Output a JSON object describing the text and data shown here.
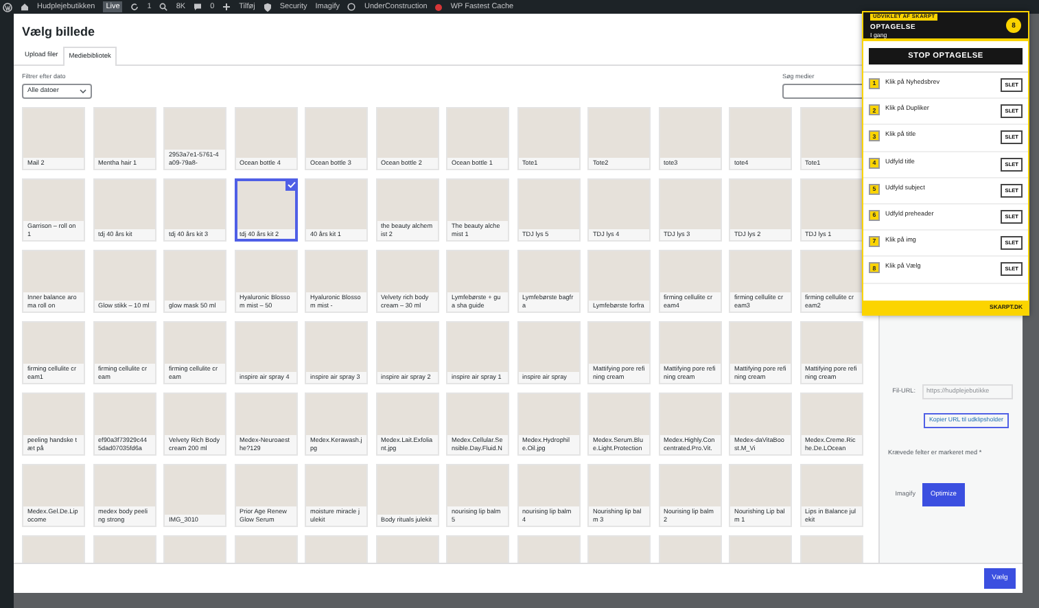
{
  "admin_bar": {
    "site": "Hudplejebutikken",
    "badge": "Live",
    "updates": "1",
    "stat": "8K",
    "comments": "0",
    "new": "Tilføj",
    "links": [
      "Security",
      "Imagify"
    ],
    "status_link": "UnderConstruction",
    "cache": "WP Fastest Cache"
  },
  "modal": {
    "title": "Vælg billede",
    "tabs": [
      {
        "label": "Upload filer",
        "selected": false
      },
      {
        "label": "Mediebibliotek",
        "selected": true
      }
    ],
    "filter": {
      "label": "Filtrer efter dato",
      "value": "Alle datoer"
    },
    "search": {
      "label": "Søg medier"
    },
    "media": [
      {
        "caption": "Mail 2",
        "selected": false
      },
      {
        "caption": "Mentha hair 1",
        "selected": false
      },
      {
        "caption": "2953a7e1-5761-4a09-79a8-",
        "selected": false
      },
      {
        "caption": "Ocean bottle 4",
        "selected": false
      },
      {
        "caption": "Ocean bottle 3",
        "selected": false
      },
      {
        "caption": "Ocean bottle 2",
        "selected": false
      },
      {
        "caption": "Ocean bottle 1",
        "selected": false
      },
      {
        "caption": "Tote1",
        "selected": false
      },
      {
        "caption": "Tote2",
        "selected": false
      },
      {
        "caption": "tote3",
        "selected": false
      },
      {
        "caption": "tote4",
        "selected": false
      },
      {
        "caption": "Tote1",
        "selected": false
      },
      {
        "caption": "Garrison – roll on 1",
        "selected": false
      },
      {
        "caption": "tdj 40 års kit",
        "selected": false
      },
      {
        "caption": "tdj 40 års kit 3",
        "selected": false
      },
      {
        "caption": "tdj 40 års kit 2",
        "selected": true
      },
      {
        "caption": "40 års kit 1",
        "selected": false
      },
      {
        "caption": "the beauty alchemist 2",
        "selected": false
      },
      {
        "caption": "The beauty alchemist 1",
        "selected": false
      },
      {
        "caption": "TDJ lys 5",
        "selected": false
      },
      {
        "caption": "TDJ lys 4",
        "selected": false
      },
      {
        "caption": "TDJ lys 3",
        "selected": false
      },
      {
        "caption": "TDJ lys 2",
        "selected": false
      },
      {
        "caption": "TDJ lys 1",
        "selected": false
      },
      {
        "caption": "Inner balance aroma roll on",
        "selected": false
      },
      {
        "caption": "Glow stikk – 10 ml",
        "selected": false
      },
      {
        "caption": "glow mask 50 ml",
        "selected": false
      },
      {
        "caption": "Hyaluronic Blossom mist – 50",
        "selected": false
      },
      {
        "caption": "Hyaluronic Blossom mist -",
        "selected": false
      },
      {
        "caption": "Velvety rich body cream – 30 ml",
        "selected": false
      },
      {
        "caption": "Lymfebørste + gua sha guide",
        "selected": false
      },
      {
        "caption": "Lymfebørste bagfra",
        "selected": false
      },
      {
        "caption": "Lymfebørste forfra",
        "selected": false
      },
      {
        "caption": "firming cellulite cream4",
        "selected": false
      },
      {
        "caption": "firming cellulite cream3",
        "selected": false
      },
      {
        "caption": "firming cellulite cream2",
        "selected": false
      },
      {
        "caption": "firming cellulite cream1",
        "selected": false
      },
      {
        "caption": "firming cellulite cream",
        "selected": false
      },
      {
        "caption": "firming cellulite cream",
        "selected": false
      },
      {
        "caption": "inspire air spray 4",
        "selected": false
      },
      {
        "caption": "inspire air spray 3",
        "selected": false
      },
      {
        "caption": "inspire air spray 2",
        "selected": false
      },
      {
        "caption": "inspire air spray 1",
        "selected": false
      },
      {
        "caption": "inspire air spray",
        "selected": false
      },
      {
        "caption": "Mattifying pore refining cream",
        "selected": false
      },
      {
        "caption": "Mattifying pore refining cream",
        "selected": false
      },
      {
        "caption": "Mattifying pore refining cream",
        "selected": false
      },
      {
        "caption": "Mattifying pore refining cream",
        "selected": false
      },
      {
        "caption": "peeling handske tæt på",
        "selected": false
      },
      {
        "caption": "ef90a3f73929c44 5dad07035fd6a",
        "selected": false
      },
      {
        "caption": "Velvety Rich Body cream 200 ml",
        "selected": false
      },
      {
        "caption": "Medex-Neuroaesthe?129",
        "selected": false
      },
      {
        "caption": "Medex.Kerawash.jpg",
        "selected": false
      },
      {
        "caption": "Medex.Lait.Exfoliant.jpg",
        "selected": false
      },
      {
        "caption": "Medex.Cellular.Sensible.Day.Fluid.N",
        "selected": false
      },
      {
        "caption": "Medex.Hydrophile.Oil.jpg",
        "selected": false
      },
      {
        "caption": "Medex.Serum.Blue.Light.Protection",
        "selected": false
      },
      {
        "caption": "Medex.Highly.Concentrated.Pro.Vit.",
        "selected": false
      },
      {
        "caption": "Medex-daVitaBoost.M_Vi",
        "selected": false
      },
      {
        "caption": "Medex.Creme.Riche.De.LOcean",
        "selected": false
      },
      {
        "caption": "Medex.Gel.De.Lipocome",
        "selected": false
      },
      {
        "caption": "medex body peeling strong",
        "selected": false
      },
      {
        "caption": "IMG_3010",
        "selected": false
      },
      {
        "caption": "Prior Age Renew Glow Serum",
        "selected": false
      },
      {
        "caption": "moisture miracle julekit",
        "selected": false
      },
      {
        "caption": "Body rituals julekit",
        "selected": false
      },
      {
        "caption": "nourising lip balm 5",
        "selected": false
      },
      {
        "caption": "nourising lip balm 4",
        "selected": false
      },
      {
        "caption": "Nourishing lip balm 3",
        "selected": false
      },
      {
        "caption": "Nourising lip balm 2",
        "selected": false
      },
      {
        "caption": "Nourishing Lip balm 1",
        "selected": false
      },
      {
        "caption": "Lips in Balance julekit",
        "selected": false
      },
      {
        "selected": false
      },
      {
        "selected": false
      },
      {
        "selected": false
      },
      {
        "selected": false
      },
      {
        "selected": false
      },
      {
        "selected": false
      },
      {
        "selected": false
      },
      {
        "selected": false
      },
      {
        "selected": false
      },
      {
        "selected": false
      },
      {
        "selected": false
      },
      {
        "selected": false
      }
    ],
    "details": {
      "url_label": "Fil-URL:",
      "url_value": "https://hudplejebutikke",
      "copy_button": "Kopier URL til udklipsholder",
      "required_note": "Krævede felter er markeret med *",
      "imagify_label": "Imagify",
      "optimize_button": "Optimize"
    },
    "select_button": "Vælg"
  },
  "recorder": {
    "badge": "UDVIKLET AF SKARPT",
    "title": "OPTAGELSE",
    "status": "I gang",
    "count": "8",
    "stop_button": "STOP OPTAGELSE",
    "steps": [
      {
        "number": "1",
        "label": "Klik på Nyhedsbrev",
        "delete": "SLET"
      },
      {
        "number": "2",
        "label": "Klik på Dupliker",
        "delete": "SLET"
      },
      {
        "number": "3",
        "label": "Klik på title",
        "delete": "SLET"
      },
      {
        "number": "4",
        "label": "Udfyld title",
        "delete": "SLET"
      },
      {
        "number": "5",
        "label": "Udfyld subject",
        "delete": "SLET"
      },
      {
        "number": "6",
        "label": "Udfyld preheader",
        "delete": "SLET"
      },
      {
        "number": "7",
        "label": "Klik på img",
        "delete": "SLET"
      },
      {
        "number": "8",
        "label": "Klik på Vælg",
        "delete": "SLET"
      }
    ],
    "footer": "SKARPT.DK"
  }
}
